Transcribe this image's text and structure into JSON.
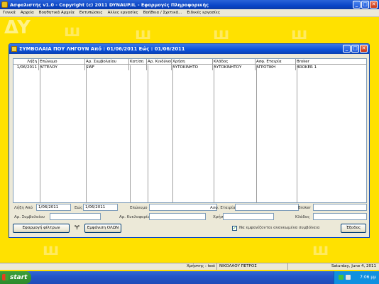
{
  "app": {
    "title": "Ασφαλιστής v1.0  -  Copyright (c) 2011 DYNAUP.IL - Εφαρμογές Πληροφορικής",
    "menu": [
      "Γενικά",
      "Αρχεία",
      "Βοηθητικά Αρχεία",
      "Εκτυπώσεις",
      "Αλλες εργασίες",
      "Βοήθεια / Σχετικά...",
      "Ειδικές εργασίες"
    ]
  },
  "window": {
    "title": "ΣΥΜΒΟΛΑΙΑ ΠΟΥ ΛΗΓΟΥΝ  Από : 01/06/2011  Εώς : 01/06/2011"
  },
  "grid": {
    "columns": [
      "Λήξη",
      "Επώνυμο",
      "Αρ. Συμβολαίου",
      "Κατ/ση",
      "Αρ. Κινδύνου",
      "Χρήση",
      "Κλάδος",
      "Ασφ. Εταιρία",
      "Broker"
    ],
    "rows": [
      [
        "1/06/2011",
        "ΑΓΓΕΛΟΥ",
        "SWF",
        "",
        "",
        "ΑΥΤΟΚΙΝΗΤΟ",
        "ΑΥΤΟΚΙΝΗΤΟΥ",
        "ΑΓΡΟΤΙΚΗ",
        "BROKER 1"
      ]
    ]
  },
  "filters": {
    "from_label": "Λήξη Από",
    "from_value": "1/06/2011",
    "to_label": "Εώς",
    "to_value": "1/06/2011",
    "surname_label": "Επώνυμο",
    "surname_value": "",
    "company_label": "Ασφ. Εταιρία",
    "company_value": "",
    "broker_label": "Broker",
    "broker_value": "",
    "policy_label": "Αρ. Συμβολαίου",
    "policy_value": "",
    "registration_label": "Αρ. Κυκλοφορίας",
    "registration_value": "",
    "use_label": "Χρήση",
    "use_value": "",
    "branch_label": "Κλάδος",
    "branch_value": ""
  },
  "buttons": {
    "apply_filters": "Εφαρμογή φίλτρων",
    "show_all": "Εμφάνιση ΟΛΩΝ",
    "exit": "Έξοδος"
  },
  "checkbox": {
    "label": "Να εμφανίζονται ανανεωμένα συμβόλαια",
    "checked": true
  },
  "statusbar": {
    "user": "Χρήστης : test",
    "name": "ΝΙΚΟΛΑΟΥ ΠΕΤΡΟΣ",
    "date": "Saturday, June 4, 2011"
  },
  "taskbar": {
    "start": "start",
    "clock": "7:06 μμ"
  },
  "colors": {
    "desktop": "#ffe100",
    "titlebar": "#0a46c8"
  }
}
